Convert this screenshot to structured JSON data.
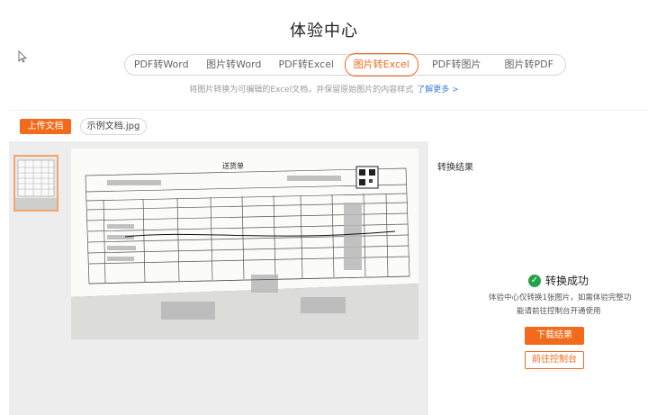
{
  "page": {
    "title": "体验中心",
    "subtitle": "将图片转换为可编辑的Excel文档，并保留原始图片的内容样式",
    "learn_more": "了解更多 >"
  },
  "tabs": [
    {
      "label": "PDF转Word",
      "active": false
    },
    {
      "label": "图片转Word",
      "active": false
    },
    {
      "label": "PDF转Excel",
      "active": false
    },
    {
      "label": "图片转Excel",
      "active": true
    },
    {
      "label": "PDF转图片",
      "active": false
    },
    {
      "label": "图片转PDF",
      "active": false
    }
  ],
  "toolbar": {
    "upload_label": "上传文档",
    "file_name": "示例文档.jpg"
  },
  "document": {
    "title": "送货单"
  },
  "result": {
    "heading": "转换结果",
    "status": "转换成功",
    "note_line1": "体验中心仅转换1张图片，如需体验完整功",
    "note_line2": "能请前往控制台开通使用",
    "download_label": "下载结果",
    "console_label": "前往控制台"
  },
  "colors": {
    "accent": "#f26b1d",
    "link": "#3b7fd6",
    "success": "#22a447"
  }
}
